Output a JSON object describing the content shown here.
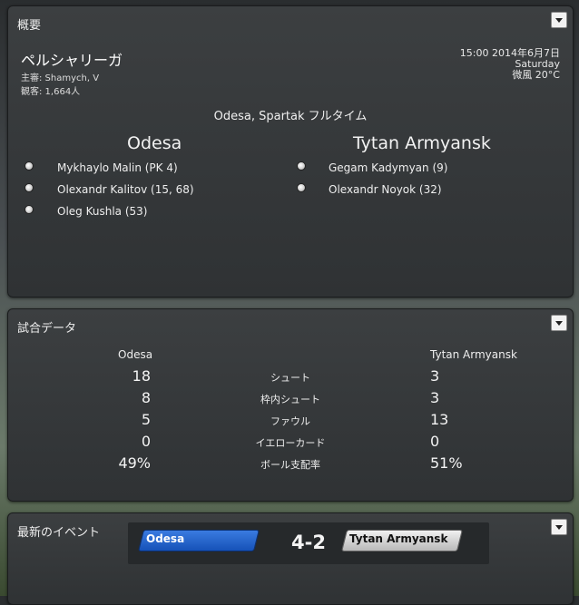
{
  "overview": {
    "title": "概要",
    "league": "ペルシャリーガ",
    "referee": "主審: Shamych, V",
    "attendance": "観客: 1,664人",
    "datetime": "15:00 2014年6月7日",
    "weekday": "Saturday",
    "weather": "微風 20°C",
    "venue_status": "Odesa, Spartak フルタイム",
    "home_team": "Odesa",
    "away_team": "Tytan Armyansk",
    "home_scorers": [
      "Mykhaylo Malin (PK 4)",
      "Olexandr Kalitov (15, 68)",
      "Oleg Kushla (53)"
    ],
    "away_scorers": [
      "Gegam Kadymyan (9)",
      "Olexandr Noyok (32)"
    ]
  },
  "stats": {
    "title": "試合データ",
    "home_team": "Odesa",
    "away_team": "Tytan Armyansk",
    "rows": [
      {
        "label": "シュート",
        "home": "18",
        "away": "3"
      },
      {
        "label": "枠内シュート",
        "home": "8",
        "away": "3"
      },
      {
        "label": "ファウル",
        "home": "5",
        "away": "13"
      },
      {
        "label": "イエローカード",
        "home": "0",
        "away": "0"
      },
      {
        "label": "ボール支配率",
        "home": "49%",
        "away": "51%"
      }
    ]
  },
  "events": {
    "title": "最新のイベント",
    "home_team": "Odesa",
    "away_team": "Tytan Armyansk",
    "score": "4-2"
  },
  "colors": {
    "home_tag": "#1652b8",
    "away_tag": "#d0d0d0",
    "panel_bg": "#333638"
  }
}
